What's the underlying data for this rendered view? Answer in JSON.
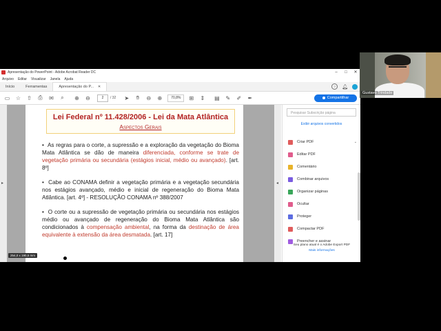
{
  "window": {
    "title": "Apresentação do PowerPoint - Adobe Acrobat Reader DC"
  },
  "menu": [
    "Arquivo",
    "Editar",
    "Visualizar",
    "Janela",
    "Ajuda"
  ],
  "tabs": {
    "home": "Início",
    "tools": "Ferramentas",
    "doc": "Apresentação do P..."
  },
  "toolbar": {
    "page_current": "2",
    "page_total": "/ 32",
    "zoom": "70,8%",
    "share_label": "Compartilhar"
  },
  "document": {
    "title": "Lei Federal nº 11.428/2006 - Lei da Mata Atlântica",
    "subtitle": "Aspectos Gerais",
    "p1_a": "As regras para o corte, a supressão e a exploração da vegetação do Bioma Mata Atlântica se dão de maneira ",
    "p1_hl": "diferenciada, conforme se trate de vegetação primária ou secundária (estágios inicial, médio ou avançado)",
    "p1_b": ". [art. 8º]",
    "p2": "Cabe ao CONAMA definir a vegetação primária e a vegetação secundária nos estágios avançado, médio e inicial de regeneração do Bioma Mata Atlântica. [art. 4º]  - RESOLUÇÃO CONAMA nº 388/2007",
    "p3_a": "O corte ou a supressão de vegetação primária ou secundária nos estágios médio ou avançado de regeneração do Bioma Mata Atlântica são condicionados à ",
    "p3_hl1": "compensação ambiental",
    "p3_b": ", na forma da ",
    "p3_hl2": "destinação de área equivalente à extensão da área desmatada",
    "p3_c": ". [art. 17]",
    "page_size_badge": "254,0 x 190,5 mm"
  },
  "panel": {
    "search_placeholder": "Pesquisar Subscrição página",
    "recent": "Exibir arquivos convertidos",
    "items": [
      {
        "label": "Criar PDF",
        "icon": "create-pdf-icon",
        "color": "#e05c5c"
      },
      {
        "label": "Editar PDF",
        "icon": "edit-pdf-icon",
        "color": "#e05c8c"
      },
      {
        "label": "Comentário",
        "icon": "comment-icon",
        "color": "#e8b32a"
      },
      {
        "label": "Combinar arquivos",
        "icon": "combine-icon",
        "color": "#7a5ce0"
      },
      {
        "label": "Organizar páginas",
        "icon": "organize-icon",
        "color": "#3aa65a"
      },
      {
        "label": "Ocultar",
        "icon": "redact-icon",
        "color": "#e05c8c"
      },
      {
        "label": "Proteger",
        "icon": "protect-icon",
        "color": "#5c6ce0"
      },
      {
        "label": "Compactar PDF",
        "icon": "compress-icon",
        "color": "#e05c5c"
      },
      {
        "label": "Preencher e assinar",
        "icon": "fill-sign-icon",
        "color": "#a05ce0"
      }
    ],
    "footer_text": "Seu plano atual é o Adobe Export PDF",
    "footer_more": "Mais informações"
  },
  "webcam": {
    "name": "Gustavo Trindade"
  }
}
